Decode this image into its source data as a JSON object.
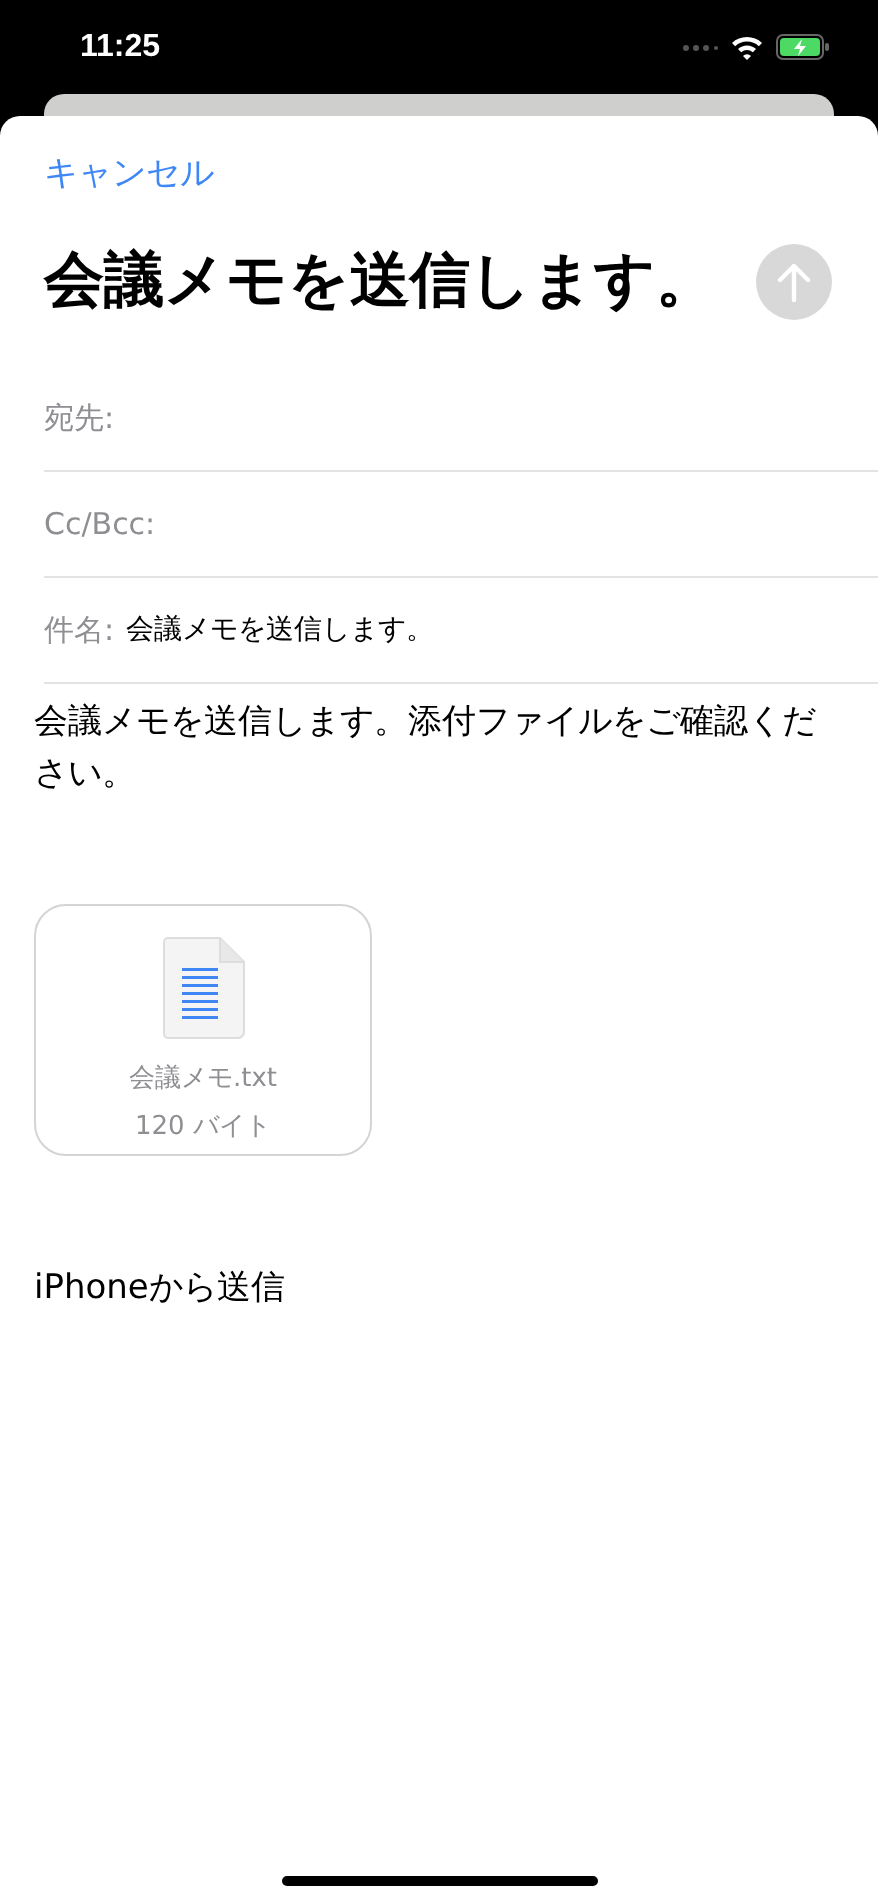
{
  "status_bar": {
    "time": "11:25"
  },
  "nav": {
    "cancel": "キャンセル"
  },
  "title": "会議メモを送信します。",
  "send_button": {
    "disabled": true
  },
  "fields": [
    {
      "label": "宛先:"
    },
    {
      "label": "Cc/Bcc:"
    },
    {
      "label": "件名:",
      "value": "会議メモを送信します。"
    }
  ],
  "body": "会議メモを送信します。添付ファイルをご確認ください。",
  "attachment": {
    "name": "会議メモ.txt",
    "size": "120 バイト"
  },
  "signature": "iPhoneから送信"
}
